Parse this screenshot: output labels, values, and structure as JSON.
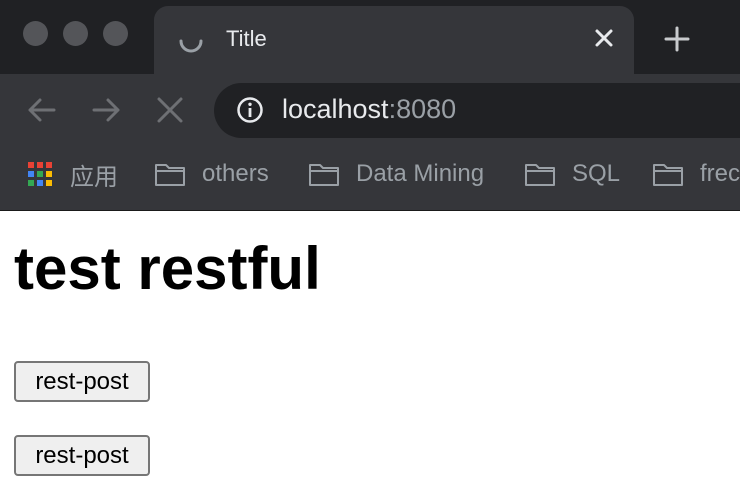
{
  "window": {
    "tab_title": "Title",
    "new_tab_label": "+"
  },
  "toolbar": {
    "url_host": "localhost",
    "url_port": ":8080"
  },
  "bookmarks": [
    {
      "label": "应用",
      "icon": "apps-grid-icon"
    },
    {
      "label": "others",
      "icon": "folder-icon"
    },
    {
      "label": "Data Mining",
      "icon": "folder-icon"
    },
    {
      "label": "SQL",
      "icon": "folder-icon"
    },
    {
      "label": "frec",
      "icon": "folder-icon"
    }
  ],
  "page": {
    "heading": "test restful",
    "buttons": [
      {
        "label": "rest-post"
      },
      {
        "label": "rest-post"
      }
    ]
  },
  "colors": {
    "tabstrip": "#202124",
    "toolbar": "#35363a",
    "text_light": "#e8eaed",
    "text_muted": "#9aa0a6"
  }
}
